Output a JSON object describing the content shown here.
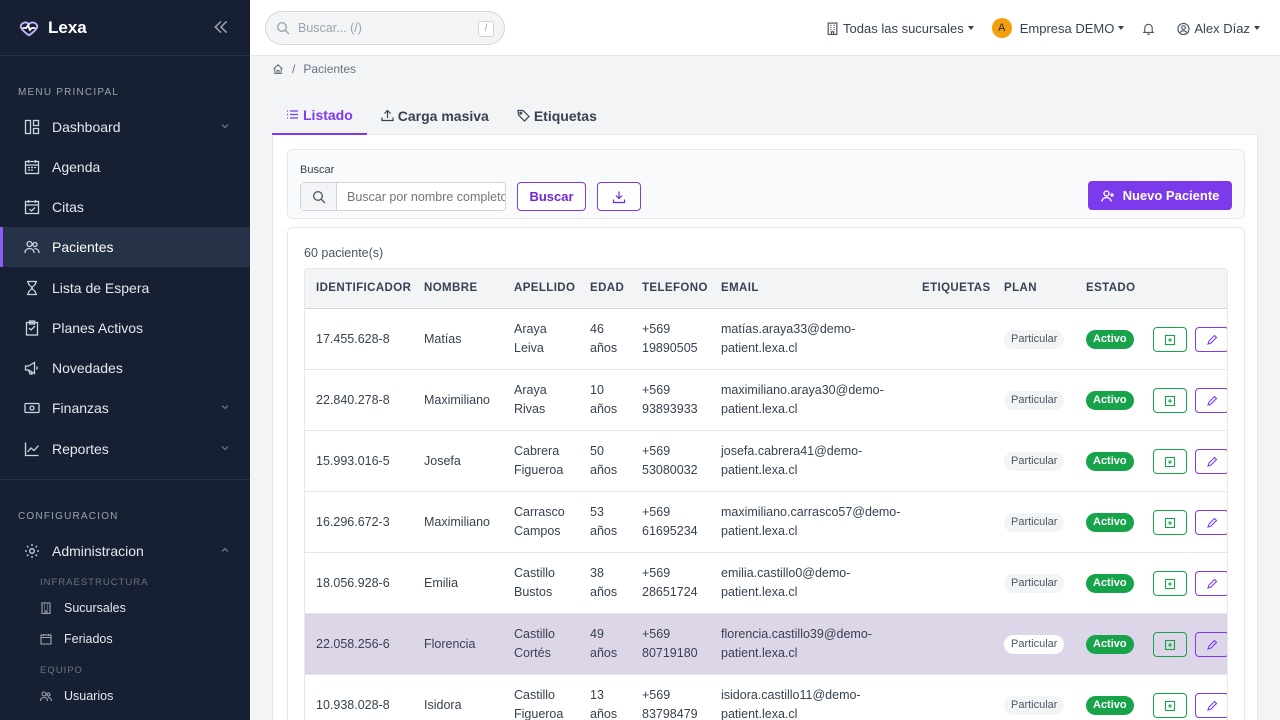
{
  "app": {
    "name": "Lexa"
  },
  "sidebar": {
    "menu_label": "MENU PRINCIPAL",
    "items": [
      {
        "label": "Dashboard",
        "icon": "dashboard-icon"
      },
      {
        "label": "Agenda",
        "icon": "calendar-icon"
      },
      {
        "label": "Citas",
        "icon": "calendar-check-icon"
      },
      {
        "label": "Pacientes",
        "icon": "users-icon"
      },
      {
        "label": "Lista de Espera",
        "icon": "hourglass-icon"
      },
      {
        "label": "Planes Activos",
        "icon": "clipboard-icon"
      },
      {
        "label": "Novedades",
        "icon": "megaphone-icon"
      },
      {
        "label": "Finanzas",
        "icon": "money-icon"
      },
      {
        "label": "Reportes",
        "icon": "chart-line-icon"
      }
    ],
    "config_label": "CONFIGURACION",
    "admin_label": "Administracion",
    "infra_label": "INFRAESTRUCTURA",
    "sucursales_label": "Sucursales",
    "feriados_label": "Feriados",
    "equipo_label": "EQUIPO",
    "usuarios_label": "Usuarios"
  },
  "topbar": {
    "search_placeholder": "Buscar... (/)",
    "search_shortcut": "/",
    "branches": "Todas las sucursales",
    "company_initial": "A",
    "company": "Empresa DEMO",
    "user": "Alex Díaz"
  },
  "breadcrumb": {
    "current": "Pacientes",
    "separator": "/"
  },
  "tabs": [
    {
      "label": "Listado"
    },
    {
      "label": "Carga masiva"
    },
    {
      "label": "Etiquetas"
    }
  ],
  "search_panel": {
    "label": "Buscar",
    "input_placeholder": "Buscar por nombre completo",
    "search_button": "Buscar",
    "new_button": "Nuevo Paciente"
  },
  "table": {
    "count": "60 paciente(s)",
    "columns": [
      "IDENTIFICADOR",
      "NOMBRE",
      "APELLIDO",
      "EDAD",
      "TELEFONO",
      "EMAIL",
      "ETIQUETAS",
      "PLAN",
      "ESTADO"
    ],
    "rows": [
      {
        "id": "17.455.628-8",
        "nombre": "Matías",
        "ap1": "Araya",
        "ap2": "Leiva",
        "edad1": "46",
        "edad2": "años",
        "tel1": "+569",
        "tel2": "19890505",
        "email1": "matías.araya33@demo-",
        "email2": "patient.lexa.cl",
        "plan": "Particular",
        "estado": "Activo"
      },
      {
        "id": "22.840.278-8",
        "nombre": "Maximiliano",
        "ap1": "Araya",
        "ap2": "Rivas",
        "edad1": "10",
        "edad2": "años",
        "tel1": "+569",
        "tel2": "93893933",
        "email1": "maximiliano.araya30@demo-",
        "email2": "patient.lexa.cl",
        "plan": "Particular",
        "estado": "Activo"
      },
      {
        "id": "15.993.016-5",
        "nombre": "Josefa",
        "ap1": "Cabrera",
        "ap2": "Figueroa",
        "edad1": "50",
        "edad2": "años",
        "tel1": "+569",
        "tel2": "53080032",
        "email1": "josefa.cabrera41@demo-",
        "email2": "patient.lexa.cl",
        "plan": "Particular",
        "estado": "Activo"
      },
      {
        "id": "16.296.672-3",
        "nombre": "Maximiliano",
        "ap1": "Carrasco",
        "ap2": "Campos",
        "edad1": "53",
        "edad2": "años",
        "tel1": "+569",
        "tel2": "61695234",
        "email1": "maximiliano.carrasco57@demo-",
        "email2": "patient.lexa.cl",
        "plan": "Particular",
        "estado": "Activo"
      },
      {
        "id": "18.056.928-6",
        "nombre": "Emilia",
        "ap1": "Castillo",
        "ap2": "Bustos",
        "edad1": "38",
        "edad2": "años",
        "tel1": "+569",
        "tel2": "28651724",
        "email1": "emilia.castillo0@demo-",
        "email2": "patient.lexa.cl",
        "plan": "Particular",
        "estado": "Activo"
      },
      {
        "id": "22.058.256-6",
        "nombre": "Florencia",
        "ap1": "Castillo",
        "ap2": "Cortés",
        "edad1": "49",
        "edad2": "años",
        "tel1": "+569",
        "tel2": "80719180",
        "email1": "florencia.castillo39@demo-",
        "email2": "patient.lexa.cl",
        "plan": "Particular",
        "estado": "Activo"
      },
      {
        "id": "10.938.028-8",
        "nombre": "Isidora",
        "ap1": "Castillo",
        "ap2": "Figueroa",
        "edad1": "13",
        "edad2": "años",
        "tel1": "+569",
        "tel2": "83798479",
        "email1": "isidora.castillo11@demo-",
        "email2": "patient.lexa.cl",
        "plan": "Particular",
        "estado": "Activo"
      }
    ]
  },
  "colors": {
    "accent": "#7c3aed",
    "sidebar": "#172033",
    "active_status": "#16a34a",
    "highlight_row": "#dcd6e8"
  }
}
